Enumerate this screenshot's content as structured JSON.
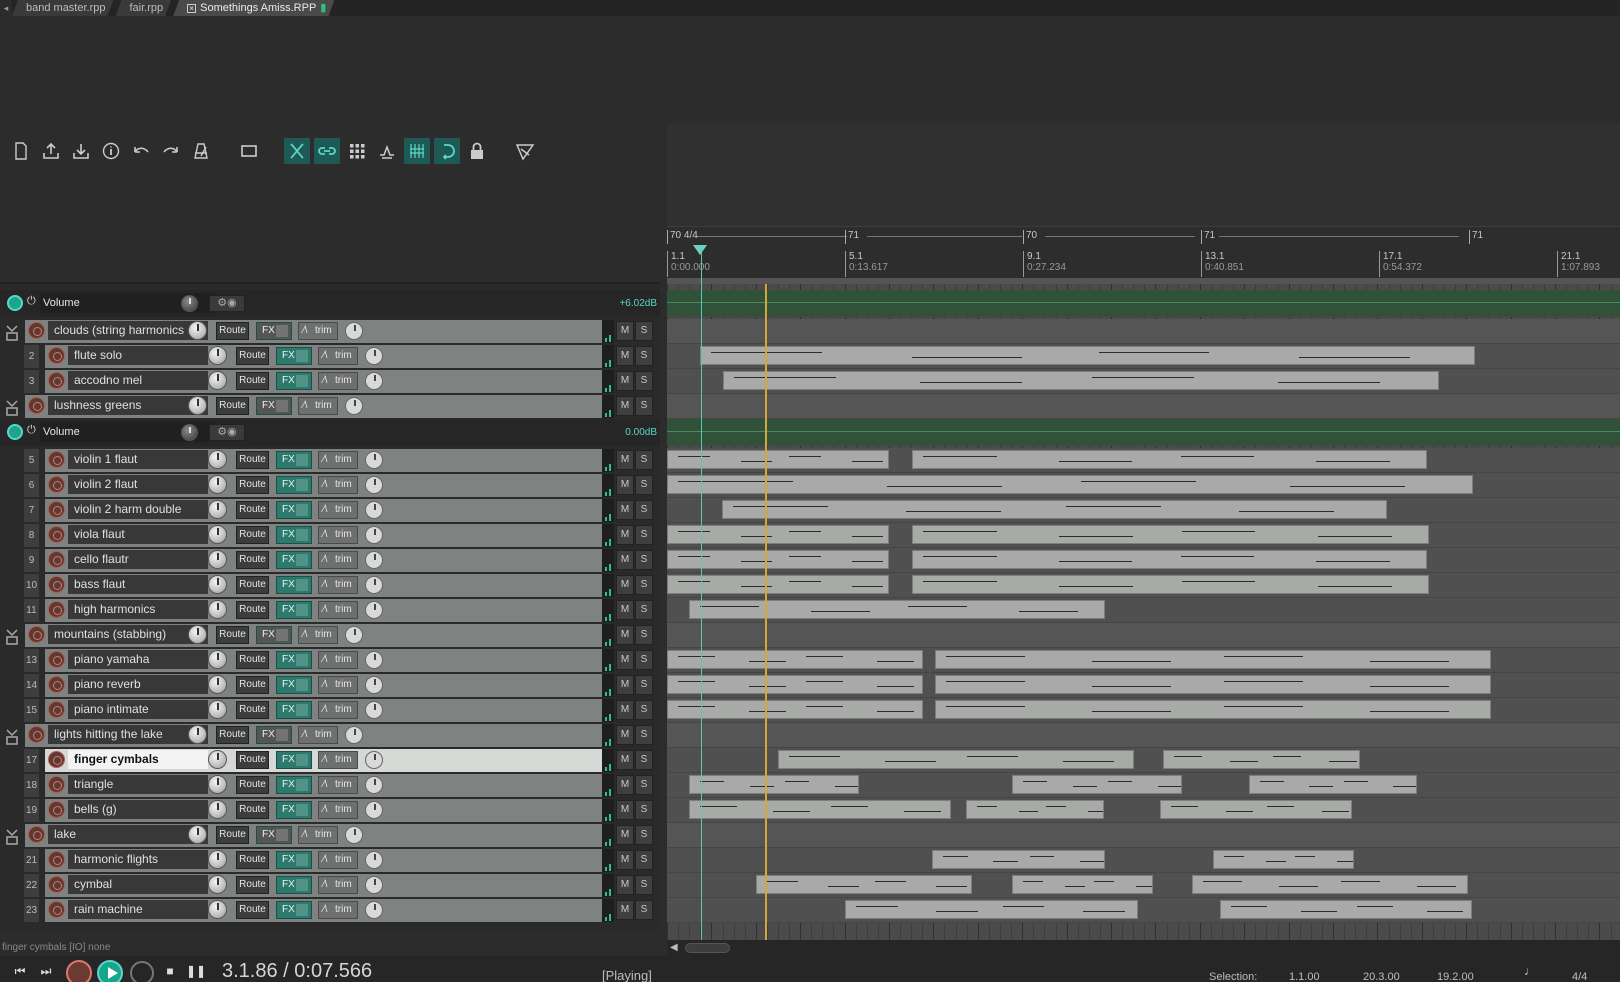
{
  "tabs": [
    {
      "label": "band master.rpp",
      "active": false
    },
    {
      "label": "fair.rpp",
      "active": false
    },
    {
      "label": "Somethings Amiss.RPP",
      "active": true
    }
  ],
  "toolbar": {
    "icons": [
      "new-project-icon",
      "open-project-icon",
      "save-project-icon",
      "project-settings-icon",
      "undo-icon",
      "redo-icon",
      "metronome-icon",
      "auto-crossfade-icon",
      "ripple-edit-icon",
      "grouping-icon",
      "snap-grid-icon",
      "envelope-link-icon",
      "grid-icon",
      "loop-icon",
      "lock-icon",
      "glue-icon"
    ],
    "accent": "#1e5a55"
  },
  "ruler": {
    "tempo_markers": [
      "70 4/4",
      "71",
      "70",
      "71",
      "71"
    ],
    "bars": [
      {
        "bar": "1.1",
        "time": "0:00.000"
      },
      {
        "bar": "5.1",
        "time": "0:13.617"
      },
      {
        "bar": "9.1",
        "time": "0:27.234"
      },
      {
        "bar": "13.1",
        "time": "0:40.851"
      },
      {
        "bar": "17.1",
        "time": "0:54.372"
      },
      {
        "bar": "21.1",
        "time": "1:07.893"
      }
    ]
  },
  "envelopes": [
    {
      "label": "Volume",
      "value": "+6.02dB"
    },
    {
      "label": "Volume",
      "value": "0.00dB"
    }
  ],
  "common": {
    "route": "Route",
    "fx": "FX",
    "trim": "trim",
    "mute": "M",
    "solo": "S"
  },
  "tracks": [
    {
      "num": "",
      "name": "clouds (string harmonics",
      "folder": true
    },
    {
      "num": "2",
      "name": "flute solo"
    },
    {
      "num": "3",
      "name": "accodno mel"
    },
    {
      "num": "",
      "name": "lushness greens",
      "folder": true
    },
    {
      "num": "5",
      "name": "violin 1 flaut"
    },
    {
      "num": "6",
      "name": "violin 2 flaut"
    },
    {
      "num": "7",
      "name": "violin 2 harm double"
    },
    {
      "num": "8",
      "name": "viola flaut"
    },
    {
      "num": "9",
      "name": "cello flautr"
    },
    {
      "num": "10",
      "name": "bass flaut"
    },
    {
      "num": "11",
      "name": "high harmonics"
    },
    {
      "num": "",
      "name": "mountains (stabbing)",
      "folder": true
    },
    {
      "num": "13",
      "name": "piano yamaha"
    },
    {
      "num": "14",
      "name": "piano reverb"
    },
    {
      "num": "15",
      "name": "piano intimate"
    },
    {
      "num": "",
      "name": "lights hitting the lake",
      "folder": true
    },
    {
      "num": "17",
      "name": "finger cymbals",
      "selected": true
    },
    {
      "num": "18",
      "name": "triangle"
    },
    {
      "num": "19",
      "name": "bells (g)"
    },
    {
      "num": "",
      "name": "lake",
      "folder": true
    },
    {
      "num": "21",
      "name": "harmonic flights"
    },
    {
      "num": "22",
      "name": "cymbal"
    },
    {
      "num": "23",
      "name": "rain machine"
    }
  ],
  "status_line": "finger cymbals [IO] none",
  "transport": {
    "time": "3.1.86 / 0:07.566",
    "state": "[Playing]",
    "selection_label": "Selection:",
    "selection_start": "1.1.00",
    "selection_end": "20.3.00",
    "selection_length": "19.2.00",
    "time_signature": "4/4"
  }
}
